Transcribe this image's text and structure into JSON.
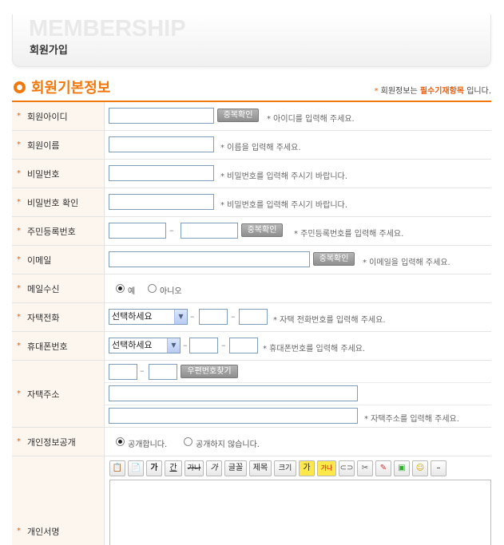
{
  "header": {
    "eng_title": "MEMBERSHIP",
    "kor_title": "회원가입"
  },
  "section": {
    "title": "회원기본정보",
    "required_note_star": "*",
    "required_note_pre": "회원정보는",
    "required_note_em": "필수기재항목",
    "required_note_post": "입니다."
  },
  "star": "*",
  "fields": {
    "user_id": {
      "label": "회원아이디",
      "button": "중복확인",
      "hint": "* 아이디를 입력해 주세요."
    },
    "name": {
      "label": "회원이름",
      "hint": "* 이름을 입력해 주세요."
    },
    "password": {
      "label": "비밀번호",
      "hint": "* 비밀번호를 입력해 주시기 바랍니다."
    },
    "password_confirm": {
      "label": "비밀번호 확인",
      "hint": "* 비밀번호를 입력해 주시기 바랍니다."
    },
    "resident_no": {
      "label": "주민등록번호",
      "dash": "–",
      "button": "중복확인",
      "hint": "* 주민등록번호를 입력해 주세요."
    },
    "email": {
      "label": "이메일",
      "button": "중복확인",
      "hint": "* 이메일을 입력해 주세요."
    },
    "mail_receive": {
      "label": "메일수신",
      "yes": "예",
      "no": "아니오",
      "selected": "예"
    },
    "home_phone": {
      "label": "자택전화",
      "select_value": "선택하세요",
      "dash": "–",
      "hint": "* 자택 전화번호를 입력해 주세요."
    },
    "mobile": {
      "label": "휴대폰번호",
      "select_value": "선택하세요",
      "dash": "–",
      "hint": "* 휴대폰번호를 입력해 주세요."
    },
    "address": {
      "label": "자택주소",
      "dash": "–",
      "button": "우편번호찾기",
      "hint": "* 자택주소를 입력해 주세요."
    },
    "privacy": {
      "label": "개인정보공개",
      "yes": "공개합니다.",
      "no": "공개하지 않습니다.",
      "selected": "공개합니다."
    },
    "signature": {
      "label": "개인서명"
    }
  },
  "editor_toolbar": {
    "bold": "가",
    "underline": "간",
    "strike": "가나",
    "italic": "가",
    "font": "글꼴",
    "heading": "제목",
    "size": "크기",
    "highlight": "가",
    "bgcolor": "가나",
    "minus": "–"
  },
  "colors": {
    "accent": "#f0780c",
    "label_bg": "#fdf6ee",
    "button_gray": "#9a9a9a"
  }
}
